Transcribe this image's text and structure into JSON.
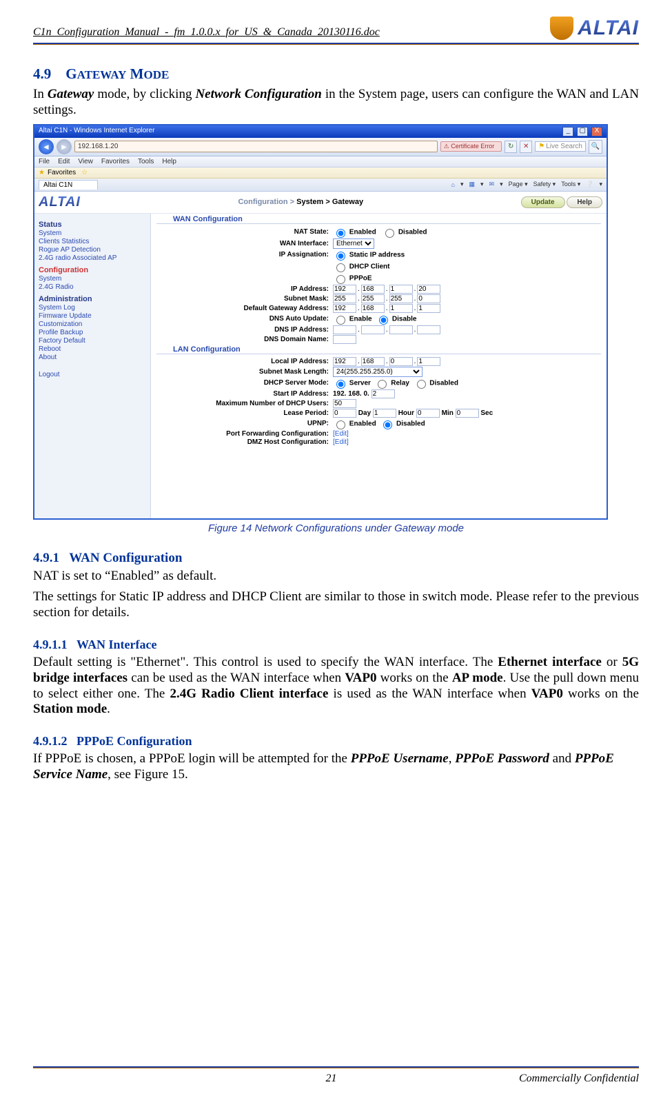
{
  "header": {
    "doc_title": "C1n_Configuration_Manual_-_fm_1.0.0.x_for_US_&_Canada_20130116.doc",
    "logo_text": "ALTAI"
  },
  "sec49": {
    "num": "4.9",
    "title": "Gateway Mode"
  },
  "intro": {
    "pre": "In ",
    "gw": "Gateway",
    "mid": " mode, by clicking ",
    "nc": "Network Configuration",
    "post": " in the System page, users can configure the WAN and LAN settings."
  },
  "browser": {
    "window_title": "Altai C1N - Windows Internet Explorer",
    "url": "192.168.1.20",
    "cert_error": "Certificate Error",
    "search_placeholder": "Live Search",
    "menu": [
      "File",
      "Edit",
      "View",
      "Favorites",
      "Tools",
      "Help"
    ],
    "fav_label": "Favorites",
    "tab_label": "Altai C1N",
    "tools": [
      "Page",
      "Safety",
      "Tools"
    ]
  },
  "app": {
    "logo": "ALTAI",
    "crumb": {
      "c": "Configuration >",
      "s": "System >",
      "g": "Gateway"
    },
    "update": "Update",
    "help": "Help",
    "sidebar": {
      "status_h": "Status",
      "status": [
        "System",
        "Clients Statistics",
        "Rogue AP Detection",
        "2.4G radio Associated AP"
      ],
      "config_h": "Configuration",
      "config": [
        "System",
        "2.4G Radio"
      ],
      "admin_h": "Administration",
      "admin": [
        "System Log",
        "Firmware Update",
        "Customization",
        "Profile Backup",
        "Factory Default",
        "Reboot",
        "About"
      ],
      "logout": "Logout"
    },
    "wan": {
      "section": "WAN Configuration",
      "nat_state": "NAT State:",
      "enabled": "Enabled",
      "disabled": "Disabled",
      "wan_iface": "WAN Interface:",
      "wan_iface_val": "Ethernet",
      "ip_assign": "IP Assignation:",
      "static": "Static IP address",
      "dhcp": "DHCP Client",
      "pppoe": "PPPoE",
      "ip_addr": "IP Address:",
      "ip": [
        "192",
        "168",
        "1",
        "20"
      ],
      "subnet": "Subnet Mask:",
      "sm": [
        "255",
        "255",
        "255",
        "0"
      ],
      "gw": "Default Gateway Address:",
      "gv": [
        "192",
        "168",
        "1",
        "1"
      ],
      "dns_auto": "DNS Auto Update:",
      "enable": "Enable",
      "disable": "Disable",
      "dns_ip": "DNS IP Address:",
      "dns_dom": "DNS Domain Name:"
    },
    "lan": {
      "section": "LAN Configuration",
      "local_ip": "Local IP Address:",
      "lip": [
        "192",
        "168",
        "0",
        "1"
      ],
      "sml": "Subnet Mask Length:",
      "sml_val": "24(255.255.255.0)",
      "dhcp_mode": "DHCP Server Mode:",
      "server": "Server",
      "relay": "Relay",
      "disabled": "Disabled",
      "start_ip": "Start IP Address:",
      "start_pref": "192. 168. 0.",
      "start_last": "2",
      "max_users": "Maximum Number of DHCP Users:",
      "max_val": "50",
      "lease": "Lease Period:",
      "day": "Day",
      "hour": "Hour",
      "min": "Min",
      "sec": "Sec",
      "lease_d": "0",
      "lease_h": "1",
      "lease_m": "0",
      "lease_s": "0",
      "upnp": "UPNP:",
      "enabled": "Enabled",
      "upnp_dis": "Disabled",
      "pf": "Port Forwarding Configuration:",
      "edit": "[Edit]",
      "dmz": "DMZ Host Configuration:"
    }
  },
  "caption": "Figure 14    Network Configurations under Gateway mode",
  "s491": {
    "num": "4.9.1",
    "title": "WAN Configuration",
    "p1": "NAT is set to “Enabled” as default.",
    "p2": "The settings for Static IP address and DHCP Client are similar to those in switch mode. Please refer to the previous section for details."
  },
  "s4911": {
    "num": "4.9.1.1",
    "title": "WAN Interface"
  },
  "p4911": {
    "a": "Default setting is \"Ethernet\". This control is used to specify the WAN interface. The ",
    "b": "Ethernet interface",
    "c": " or ",
    "d": "5G bridge interfaces",
    "e": " can be used as the WAN interface when ",
    "f": "VAP0",
    "g": " works on the ",
    "h": "AP mode",
    "i": ". Use the pull down menu to select either one. The ",
    "j": "2.4G Radio Client interface",
    "k": " is used as the WAN interface when ",
    "l": "VAP0",
    "m": " works on the ",
    "n": "Station mode",
    "o": "."
  },
  "s4912": {
    "num": "4.9.1.2",
    "title": "PPPoE Configuration"
  },
  "p4912": {
    "a": "If PPPoE is chosen, a PPPoE login will be attempted for the ",
    "b": "PPPoE Username",
    "c": ", ",
    "d": "PPPoE Password",
    "e": " and ",
    "f": "PPPoE Service Name",
    "g": ", see Figure 15."
  },
  "footer": {
    "page": "21",
    "conf": "Commercially Confidential"
  }
}
